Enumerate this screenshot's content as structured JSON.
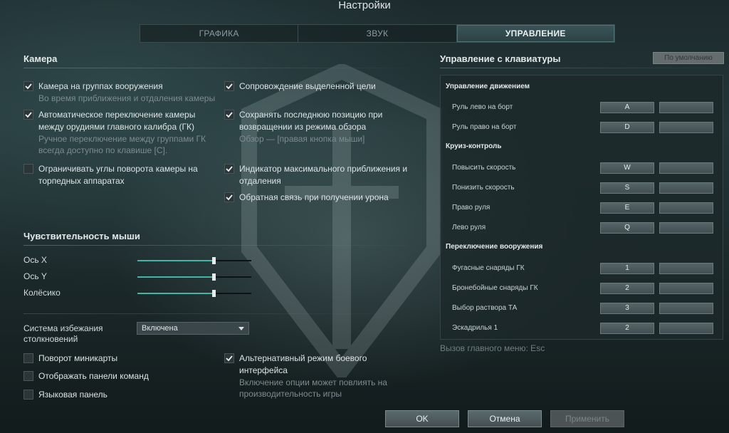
{
  "window": {
    "title": "Настройки"
  },
  "tabs": [
    {
      "label": "ГРАФИКА",
      "active": false
    },
    {
      "label": "ЗВУК",
      "active": false
    },
    {
      "label": "УПРАВЛЕНИЕ",
      "active": true
    }
  ],
  "camera": {
    "title": "Камера",
    "left": [
      {
        "label": "Камера на группах вооружения",
        "desc": "Во время приближения и отдаления камеры",
        "checked": true
      },
      {
        "label": "Автоматическое переключение камеры между орудиями главного калибра (ГК)",
        "desc": "Ручное переключение между группами ГК всегда доступно по клавише [C].",
        "checked": true
      },
      {
        "label": "Ограничивать углы поворота камеры на торпедных аппаратах",
        "desc": "",
        "checked": false
      }
    ],
    "right": [
      {
        "label": "Сопровождение выделенной цели",
        "desc": "",
        "checked": true
      },
      {
        "label": "Сохранять последнюю позицию при возвращении из режима обзора",
        "desc": "Обзор — [правая кнопка мыши]",
        "checked": true
      },
      {
        "label": "Индикатор максимального приближения и отдаления",
        "desc": "",
        "checked": true
      },
      {
        "label": "Обратная связь при получении урона",
        "desc": "",
        "checked": true
      }
    ]
  },
  "mouse": {
    "title": "Чувствительность мыши",
    "sliders": [
      {
        "label": "Ось X",
        "value": 0.67
      },
      {
        "label": "Ось Y",
        "value": 0.67
      },
      {
        "label": "Колёсико",
        "value": 0.67
      }
    ]
  },
  "collision": {
    "label": "Система избежания столкновений",
    "value": "Включена"
  },
  "misc": {
    "left": [
      {
        "label": "Поворот миникарты",
        "checked": false
      },
      {
        "label": "Отображать панели команд",
        "checked": false
      },
      {
        "label": "Языковая панель",
        "checked": false
      }
    ],
    "right": [
      {
        "label": "Альтернативный режим боевого интерфейса",
        "desc": "Включение опции может повлиять на производительность игры",
        "checked": true
      }
    ]
  },
  "keyboard": {
    "title": "Управление с клавиатуры",
    "default_button": "По умолчанию",
    "rows": [
      {
        "type": "group",
        "label": "Управление движением"
      },
      {
        "type": "bind",
        "label": "Руль лево на борт",
        "primary": "A",
        "secondary": ""
      },
      {
        "type": "bind",
        "label": "Руль право на борт",
        "primary": "D",
        "secondary": ""
      },
      {
        "type": "group",
        "label": "Круиз-контроль"
      },
      {
        "type": "bind",
        "label": "Повысить скорость",
        "primary": "W",
        "secondary": ""
      },
      {
        "type": "bind",
        "label": "Понизить скорость",
        "primary": "S",
        "secondary": ""
      },
      {
        "type": "bind",
        "label": "Право руля",
        "primary": "E",
        "secondary": ""
      },
      {
        "type": "bind",
        "label": "Лево руля",
        "primary": "Q",
        "secondary": ""
      },
      {
        "type": "group",
        "label": "Переключение вооружения"
      },
      {
        "type": "bind",
        "label": "Фугасные снаряды ГК",
        "primary": "1",
        "secondary": ""
      },
      {
        "type": "bind",
        "label": "Бронебойные снаряды ГК",
        "primary": "2",
        "secondary": ""
      },
      {
        "type": "bind",
        "label": "Выбор раствора ТА",
        "primary": "3",
        "secondary": ""
      },
      {
        "type": "bind",
        "label": "Эскадрилья 1",
        "primary": "2",
        "secondary": ""
      }
    ],
    "menu_hint": "Вызов главного меню: Esc"
  },
  "buttons": {
    "ok": "OK",
    "cancel": "Отмена",
    "apply": "Применить"
  },
  "colors": {
    "accent": "#3fb6a8",
    "active_tab": "#2c4245"
  }
}
